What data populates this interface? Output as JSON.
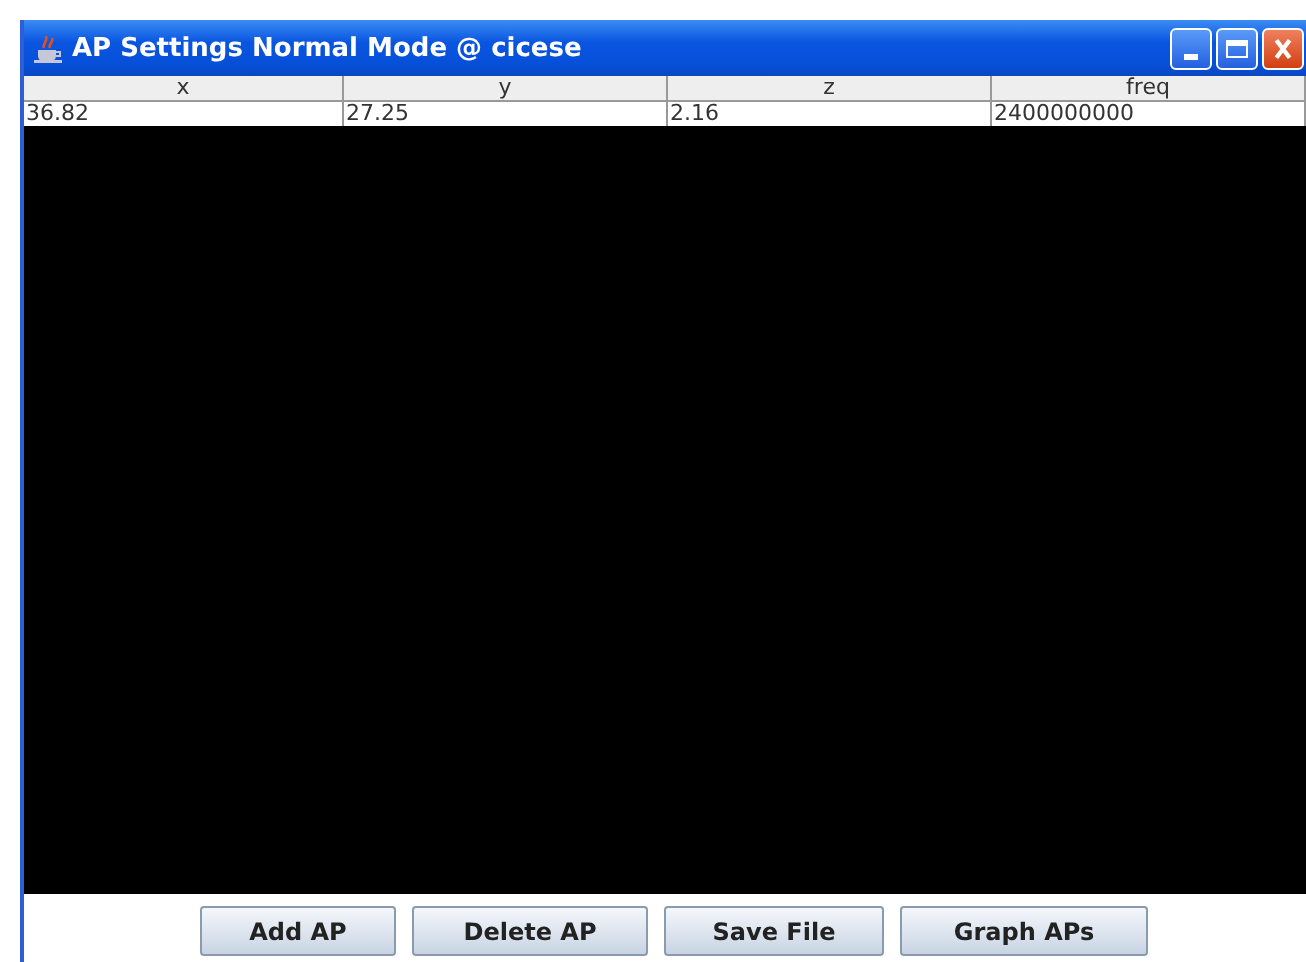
{
  "window": {
    "title": "AP Settings Normal Mode @ cicese"
  },
  "table": {
    "columns": [
      "x",
      "y",
      "z",
      "freq"
    ],
    "rows": [
      [
        "36.82",
        "27.25",
        "2.16",
        "2400000000"
      ]
    ]
  },
  "buttons": [
    "Add AP",
    "Delete AP",
    "Save File",
    "Graph APs"
  ]
}
